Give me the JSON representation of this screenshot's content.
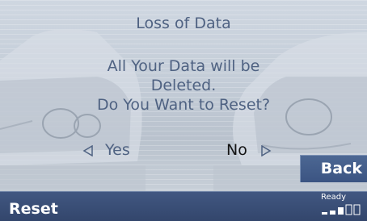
{
  "dialog": {
    "title": "Loss of Data",
    "message_lines": [
      "All Your Data will be",
      "Deleted.",
      "Do You Want to Reset?"
    ],
    "yes_label": "Yes",
    "no_label": "No",
    "selected_option": "No"
  },
  "back_button": {
    "label": "Back"
  },
  "footer": {
    "label": "Reset",
    "status": "Ready",
    "signal_bars_filled": 3,
    "signal_bars_total": 5
  },
  "colors": {
    "text_primary": "#4f6282",
    "text_selected": "#141414",
    "bar_blue": "#3b5482",
    "screen_bg": "#c9d1dc"
  },
  "icons": [
    "arrow-left-icon",
    "arrow-right-icon",
    "signal-bars-icon"
  ]
}
